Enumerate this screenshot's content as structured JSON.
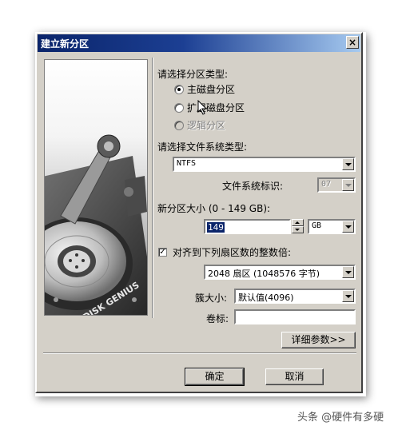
{
  "window": {
    "title": "建立新分区",
    "close_glyph": "×"
  },
  "banner": {
    "brand_text": "DISK GENIUS"
  },
  "partition_type": {
    "label": "请选择分区类型:",
    "options": [
      {
        "label": "主磁盘分区",
        "checked": true,
        "enabled": true
      },
      {
        "label": "扩展磁盘分区",
        "checked": false,
        "enabled": true
      },
      {
        "label": "逻辑分区",
        "checked": false,
        "enabled": false
      }
    ]
  },
  "filesystem": {
    "label": "请选择文件系统类型:",
    "selected": "NTFS",
    "id_label": "文件系统标识:",
    "id_value": "07"
  },
  "size": {
    "label": "新分区大小 (0 - 149 GB):",
    "value": "149",
    "unit": "GB"
  },
  "align": {
    "checked": true,
    "check_glyph": "✓",
    "label": "对齐到下列扇区数的整数倍:",
    "selected": "2048 扇区 (1048576 字节)"
  },
  "cluster": {
    "label": "簇大小:",
    "selected": "默认值(4096)"
  },
  "volume": {
    "label": "卷标:",
    "value": ""
  },
  "buttons": {
    "details": "详细参数>>",
    "ok": "确定",
    "cancel": "取消"
  },
  "watermark": "头条 @硬件有多硬"
}
